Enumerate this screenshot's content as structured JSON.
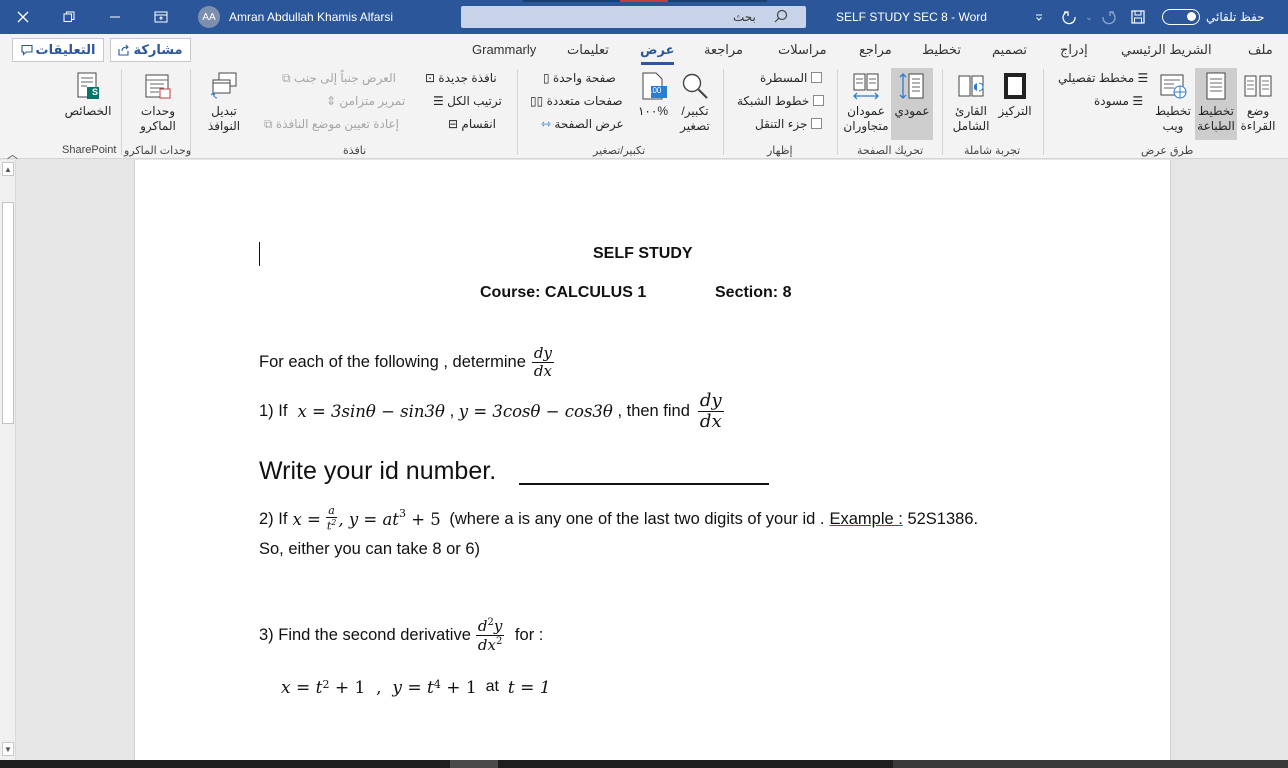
{
  "titlebar": {
    "autosave_label": "حفظ تلقائي",
    "doc_title": "SELF STUDY SEC 8  -  Word",
    "search_placeholder": "بحث",
    "user_initials": "AA",
    "user_name": "Amran Abdullah Khamis Alfarsi",
    "accent_color": "#2b579a"
  },
  "tabs": {
    "file": "ملف",
    "home": "الشريط الرئيسي",
    "insert": "إدراج",
    "design": "تصميم",
    "layout": "تخطيط",
    "references": "مراجع",
    "mailings": "مراسلات",
    "review": "مراجعة",
    "view": "عرض",
    "help": "تعليمات",
    "grammarly": "Grammarly",
    "share": "مشاركة",
    "comments": "التعليقات"
  },
  "ribbon": {
    "views": {
      "group": "طرق عرض",
      "read_mode": "وضع القراءة",
      "print_layout": "تخطيط الطباعة",
      "web_layout": "تخطيط ويب",
      "outline": "مخطط تفصيلي",
      "draft": "مسودة"
    },
    "immersive": {
      "group": "تجربة شاملة",
      "focus": "التركيز",
      "immersive_reader": "القارئ الشامل"
    },
    "page_movement": {
      "group": "تحريك الصفحة",
      "vertical": "عمودي",
      "side_to_side": "عمودان متجاوران"
    },
    "show": {
      "group": "إظهار",
      "ruler": "المسطرة",
      "gridlines": "خطوط الشبكة",
      "nav_pane": "جزء التنقل"
    },
    "zoom": {
      "group": "تكبير/تصغير",
      "zoom": "تكبير/ تصغير",
      "hundred": "١٠٠%",
      "hundred_icon": "100",
      "one_page": "صفحة واحدة",
      "multiple_pages": "صفحات متعددة",
      "page_width": "عرض الصفحة"
    },
    "window": {
      "group": "نافذة",
      "new_window": "نافذة جديدة",
      "arrange_all": "ترتيب الكل",
      "split": "انقسام",
      "side_by_side": "العرض جنباً إلى جنب",
      "sync_scroll": "تمرير متزامن",
      "reset_position": "إعادة تعيين موضع النافذة",
      "switch_windows": "تبديل النوافذ"
    },
    "macros": {
      "group": "وحدات الماكرو",
      "macros": "وحدات الماكرو"
    },
    "sharepoint": {
      "group": "SharePoint",
      "properties": "الخصائص",
      "badge": "S"
    }
  },
  "document": {
    "title": "SELF STUDY",
    "course_label": "Course: CALCULUS 1",
    "section_label": "Section: 8",
    "intro_text": "For each of the following , determine",
    "intro_frac_num": "dy",
    "intro_frac_den": "dx",
    "q1_prefix": "1)  If",
    "q1_eq1": "x = 3sinθ − sin3θ",
    "q1_sep": " , ",
    "q1_eq2": "y = 3cosθ − cos3θ",
    "q1_suffix": " , then find",
    "q1_frac_num": "dy",
    "q1_frac_den": "dx",
    "write_id": "Write your id number.",
    "q2_prefix": "2) If",
    "q2_x": "x =",
    "q2_frac_num": "a",
    "q2_frac_den_base": "t",
    "q2_frac_den_exp": "2",
    "q2_y": ", y = at",
    "q2_y_exp": "3",
    "q2_y_tail": " + 5",
    "q2_text": " (where a is any one of the last two digits of your id .",
    "q2_example": "Example :",
    "q2_example_val": " 52S1386.",
    "q2_line2": "So, either you can take 8 or 6)",
    "q3_prefix": "3) Find the second derivative",
    "q3_frac_num_base": "d",
    "q3_frac_num_exp": "2",
    "q3_frac_num_var": "y",
    "q3_frac_den_base": "dx",
    "q3_frac_den_exp": "2",
    "q3_suffix": " for :",
    "q3_x": "x = t",
    "q3_x_exp": "2",
    "q3_x_tail": " + 1  ,  ",
    "q3_y": "y = t",
    "q3_y_exp": "4",
    "q3_y_tail": " + 1",
    "q3_at": "  at  ",
    "q3_t": "t = 1"
  }
}
